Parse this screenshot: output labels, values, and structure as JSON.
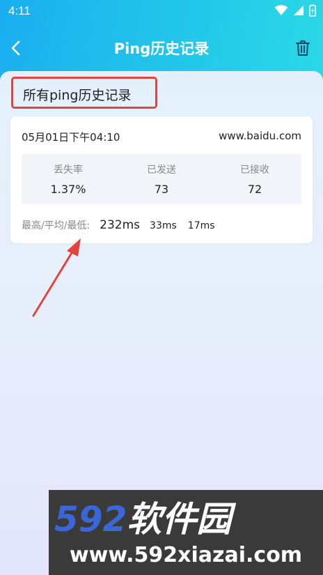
{
  "status_bar": {
    "time": "4:11",
    "icons": [
      "wifi-icon",
      "cell-signal-icon",
      "battery-charging-icon"
    ]
  },
  "app_bar": {
    "title": "Ping历史记录",
    "back_icon": "chevron-left-icon",
    "delete_icon": "trash-icon"
  },
  "section": {
    "title": "所有ping历史记录",
    "highlight_color": "#e0443a"
  },
  "history": [
    {
      "date": "05月01日下午04:10",
      "host": "www.baidu.com",
      "stats": [
        {
          "label": "丢失率",
          "value": "1.37%"
        },
        {
          "label": "已发送",
          "value": "73"
        },
        {
          "label": "已接收",
          "value": "72"
        }
      ],
      "latency": {
        "label": "最高/平均/最低:",
        "max": "232ms",
        "avg": "33ms",
        "min": "17ms"
      }
    }
  ],
  "watermark": {
    "number": "592",
    "brand": "软件园",
    "url": "www.592xiazai.com"
  },
  "colors": {
    "header_start": "#1aaef0",
    "header_end": "#2bd8e6",
    "arrow": "#e0443a"
  }
}
